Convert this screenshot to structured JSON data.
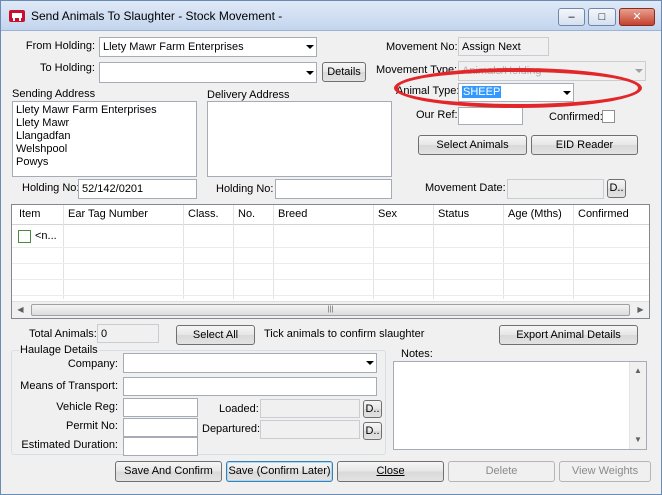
{
  "window": {
    "title": "Send Animals To Slaughter - Stock Movement -",
    "minimize": "–",
    "maximize": "□",
    "close": "✕"
  },
  "form": {
    "from_holding_label": "From Holding:",
    "from_holding_value": "Llety Mawr Farm Enterprises",
    "to_holding_label": "To Holding:",
    "to_holding_value": "",
    "details_button": "Details",
    "movement_no_label": "Movement No:",
    "movement_no_value": "Assign Next",
    "movement_type_label": "Movement Type:",
    "movement_type_value": "Animals/Holding",
    "animal_type_label": "Animal Type:",
    "animal_type_value": "SHEEP",
    "our_ref_label": "Our Ref:",
    "our_ref_value": "",
    "confirmed_label": "Confirmed:",
    "sending_address_label": "Sending Address",
    "sending_address_lines": [
      "Llety Mawr Farm Enterprises",
      "Llety Mawr",
      "Llangadfan",
      "Welshpool",
      "Powys"
    ],
    "delivery_address_label": "Delivery Address",
    "select_animals_button": "Select Animals",
    "eid_reader_button": "EID Reader",
    "holding_no_label": "Holding No:",
    "holding_no_value": "52/142/0201",
    "delivery_holding_no_label": "Holding No:",
    "delivery_holding_no_value": "",
    "movement_date_label": "Movement Date:",
    "movement_date_value": "",
    "date_picker_button": "D.."
  },
  "grid": {
    "columns": [
      "Item",
      "Ear Tag Number",
      "Class.",
      "No.",
      "Breed",
      "Sex",
      "Status",
      "Age (Mths)",
      "Confirmed"
    ],
    "rows": [
      {
        "item": "<n..."
      }
    ],
    "scroll_thumb_grip": "|||"
  },
  "totals": {
    "total_animals_label": "Total Animals:",
    "total_animals_value": "0",
    "select_all_button": "Select All",
    "tick_hint": "Tick animals to confirm slaughter",
    "export_button": "Export Animal Details"
  },
  "haulage": {
    "group_label": "Haulage Details",
    "company_label": "Company:",
    "company_value": "",
    "transport_label": "Means of Transport:",
    "transport_value": "",
    "vehicle_reg_label": "Vehicle Reg:",
    "vehicle_reg_value": "",
    "permit_label": "Permit No:",
    "permit_value": "",
    "duration_label": "Estimated Duration:",
    "duration_value": "",
    "loaded_label": "Loaded:",
    "loaded_value": "",
    "departured_label": "Departured:",
    "departured_value": "",
    "loaded_picker": "D..",
    "departured_picker": "D..",
    "notes_label": "Notes:"
  },
  "buttons": {
    "save_confirm": "Save And Confirm",
    "save_later": "Save (Confirm Later)",
    "close": "Close",
    "delete": "Delete",
    "view_weights": "View Weights"
  },
  "colors": {
    "annotation_ellipse": "#e3262a",
    "selection": "#3399ff"
  }
}
